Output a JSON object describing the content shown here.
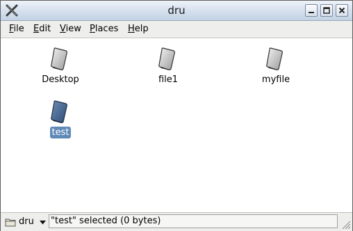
{
  "window": {
    "title": "dru",
    "controls": [
      "minimize",
      "maximize",
      "close"
    ]
  },
  "menubar": {
    "items": [
      {
        "label": "File",
        "mnemonic": "F",
        "rest": "ile"
      },
      {
        "label": "Edit",
        "mnemonic": "E",
        "rest": "dit"
      },
      {
        "label": "View",
        "mnemonic": "V",
        "rest": "iew"
      },
      {
        "label": "Places",
        "mnemonic": "P",
        "rest": "laces"
      },
      {
        "label": "Help",
        "mnemonic": "H",
        "rest": "elp"
      }
    ]
  },
  "files": [
    {
      "name": "Desktop",
      "icon": "document-icon",
      "selected": false
    },
    {
      "name": "file1",
      "icon": "document-icon",
      "selected": false
    },
    {
      "name": "myfile",
      "icon": "document-icon",
      "selected": false
    },
    {
      "name": "test",
      "icon": "document-icon",
      "selected": true
    }
  ],
  "statusbar": {
    "location": "dru",
    "status": "\"test\" selected (0 bytes)"
  },
  "colors": {
    "selection": "#5f89b7",
    "titlebar": "#d6e1ee"
  }
}
